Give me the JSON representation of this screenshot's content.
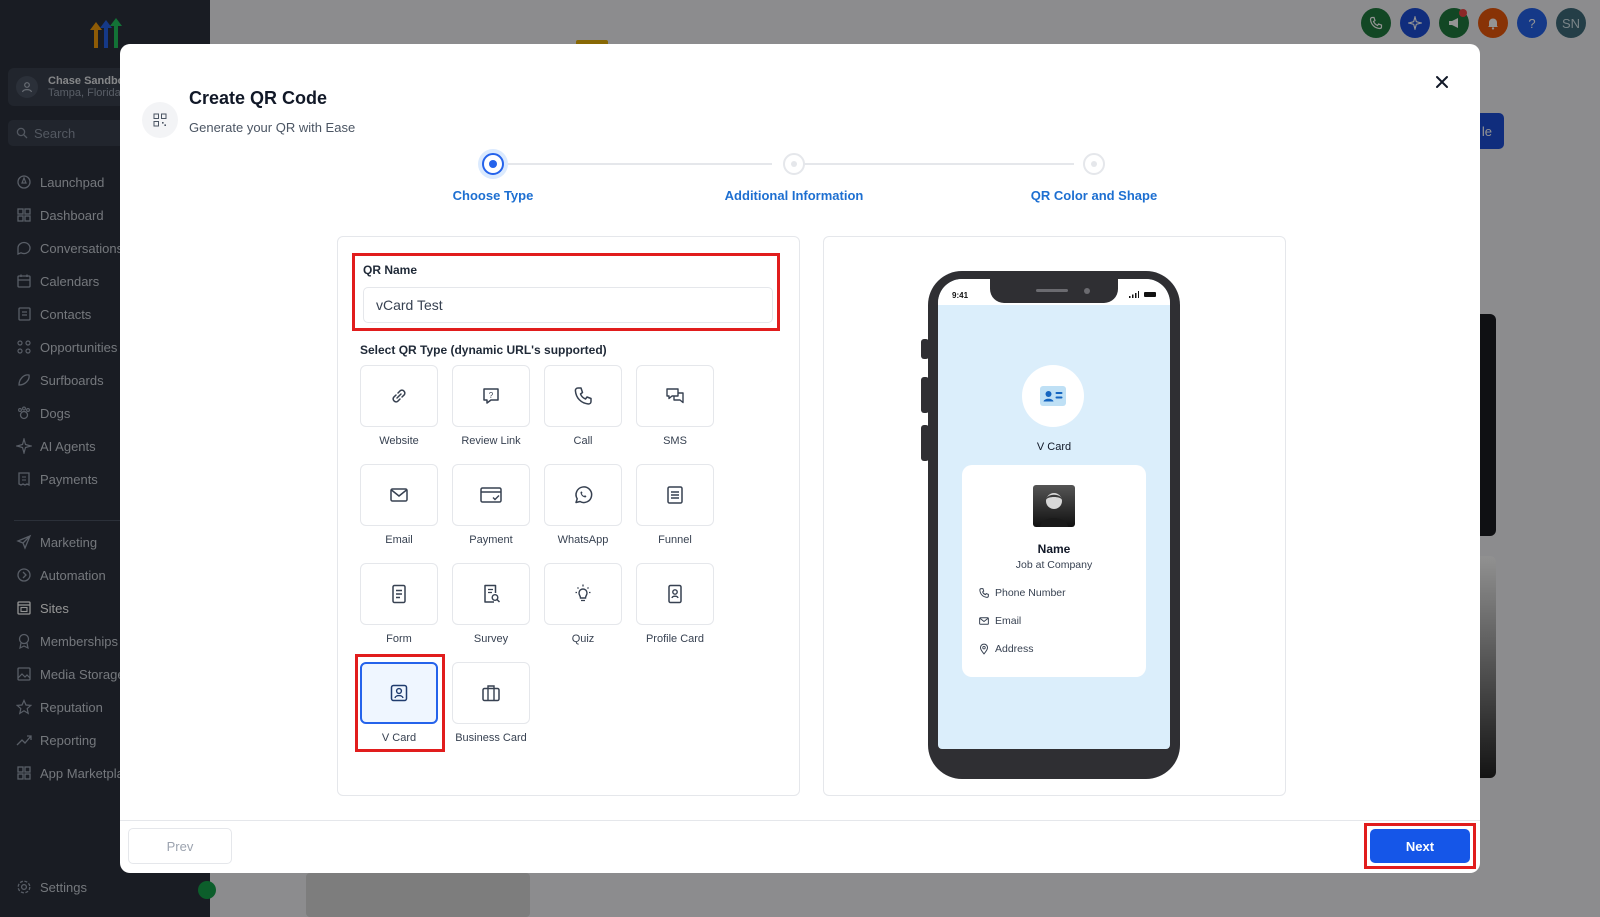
{
  "sidebar": {
    "account_name": "Chase Sandbox",
    "account_location": "Tampa, Florida",
    "search_placeholder": "Search",
    "items": [
      {
        "label": "Launchpad",
        "icon": "rocket-icon"
      },
      {
        "label": "Dashboard",
        "icon": "grid-icon"
      },
      {
        "label": "Conversations",
        "icon": "chat-icon"
      },
      {
        "label": "Calendars",
        "icon": "calendar-icon"
      },
      {
        "label": "Contacts",
        "icon": "contacts-icon"
      },
      {
        "label": "Opportunities",
        "icon": "pipeline-icon"
      },
      {
        "label": "Surfboards",
        "icon": "surfboard-icon"
      },
      {
        "label": "Dogs",
        "icon": "paw-icon"
      },
      {
        "label": "AI Agents",
        "icon": "sparkle-icon"
      },
      {
        "label": "Payments",
        "icon": "receipt-icon"
      },
      {
        "label": "Marketing",
        "icon": "send-icon"
      },
      {
        "label": "Automation",
        "icon": "automation-icon"
      },
      {
        "label": "Sites",
        "icon": "sites-icon"
      },
      {
        "label": "Memberships",
        "icon": "award-icon"
      },
      {
        "label": "Media Storage",
        "icon": "image-icon"
      },
      {
        "label": "Reputation",
        "icon": "star-icon"
      },
      {
        "label": "Reporting",
        "icon": "trend-icon"
      },
      {
        "label": "App Marketplace",
        "icon": "apps-icon"
      }
    ],
    "settings_label": "Settings"
  },
  "topbar": {
    "icons": [
      {
        "name": "phone-icon",
        "color": "#1f7a3e"
      },
      {
        "name": "sparkle-icon",
        "color": "#1d4ed8"
      },
      {
        "name": "megaphone-icon",
        "color": "#1f7a3e"
      },
      {
        "name": "bell-icon",
        "color": "#ea580c"
      },
      {
        "name": "help-icon",
        "color": "#2563eb"
      },
      {
        "name": "user-avatar",
        "color": "#3f6b7a"
      }
    ],
    "help_glyph": "?",
    "avatar_initials": "SN"
  },
  "background": {
    "button_label_fragment": "le"
  },
  "modal": {
    "title": "Create QR Code",
    "subtitle": "Generate your QR with Ease",
    "steps": [
      {
        "label": "Choose Type",
        "active": true
      },
      {
        "label": "Additional Information",
        "active": false
      },
      {
        "label": "QR Color and Shape",
        "active": false
      }
    ],
    "qr_name_label": "QR Name",
    "qr_name_value": "vCard Test",
    "qr_type_label": "Select QR Type (dynamic URL's supported)",
    "qr_types": [
      {
        "label": "Website",
        "icon": "link-icon"
      },
      {
        "label": "Review Link",
        "icon": "review-icon"
      },
      {
        "label": "Call",
        "icon": "phone-icon"
      },
      {
        "label": "SMS",
        "icon": "sms-icon"
      },
      {
        "label": "Email",
        "icon": "email-icon"
      },
      {
        "label": "Payment",
        "icon": "payment-icon"
      },
      {
        "label": "WhatsApp",
        "icon": "whatsapp-icon"
      },
      {
        "label": "Funnel",
        "icon": "funnel-icon"
      },
      {
        "label": "Form",
        "icon": "form-icon"
      },
      {
        "label": "Survey",
        "icon": "survey-icon"
      },
      {
        "label": "Quiz",
        "icon": "bulb-icon"
      },
      {
        "label": "Profile Card",
        "icon": "profile-card-icon"
      },
      {
        "label": "V Card",
        "icon": "vcard-icon",
        "selected": true
      },
      {
        "label": "Business Card",
        "icon": "briefcase-icon"
      }
    ],
    "preview": {
      "time": "9:41",
      "type_label": "V Card",
      "name": "Name",
      "job": "Job at Company",
      "phone": "Phone Number",
      "email": "Email",
      "address": "Address"
    },
    "prev_label": "Prev",
    "next_label": "Next"
  },
  "colors": {
    "primary": "#1556e8",
    "step_label": "#1d6fd1",
    "highlight": "#e11d1d",
    "sidebar_bg": "#2b313d"
  }
}
